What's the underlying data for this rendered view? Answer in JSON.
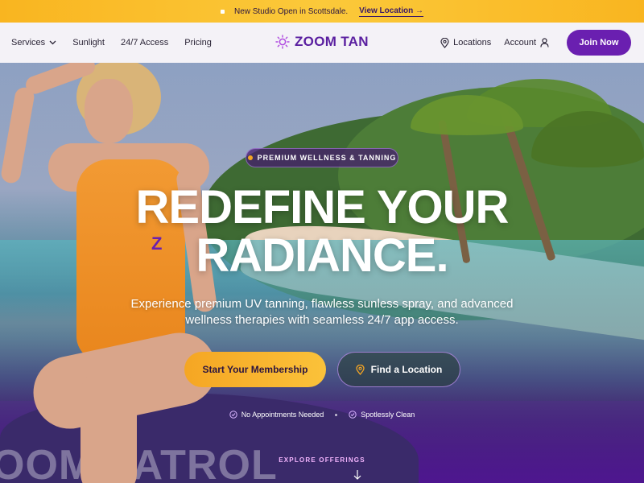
{
  "announcement": {
    "text": "New Studio Open in Scottsdale.",
    "link_label": "View Location"
  },
  "header": {
    "nav_left": [
      {
        "label": "Services"
      },
      {
        "label": "Sunlight"
      },
      {
        "label": "24/7 Access"
      },
      {
        "label": "Pricing"
      }
    ],
    "logo": "ZOOM TAN",
    "nav_right": {
      "locations": "Locations",
      "account": "Account",
      "join": "Join Now"
    }
  },
  "hero": {
    "badge": "PREMIUM WELLNESS & TANNING",
    "headline_line1": "REDEFINE YOUR",
    "headline_line2": "RADIANCE.",
    "subhead": "Experience premium UV tanning, flawless sunless spray, and advanced wellness therapies with seamless 24/7 app access.",
    "cta_primary": "Start Your Membership",
    "cta_secondary": "Find a Location",
    "features": [
      "No Appointments Needed",
      "Spotlessly Clean"
    ],
    "explore": "EXPLORE OFFERINGS",
    "boat_text": "OOM PATROL",
    "z_mark": "Z"
  },
  "colors": {
    "brand_purple": "#6a1fb0",
    "accent_gold": "#f5a623",
    "announce_bg": "#fbc93a"
  }
}
